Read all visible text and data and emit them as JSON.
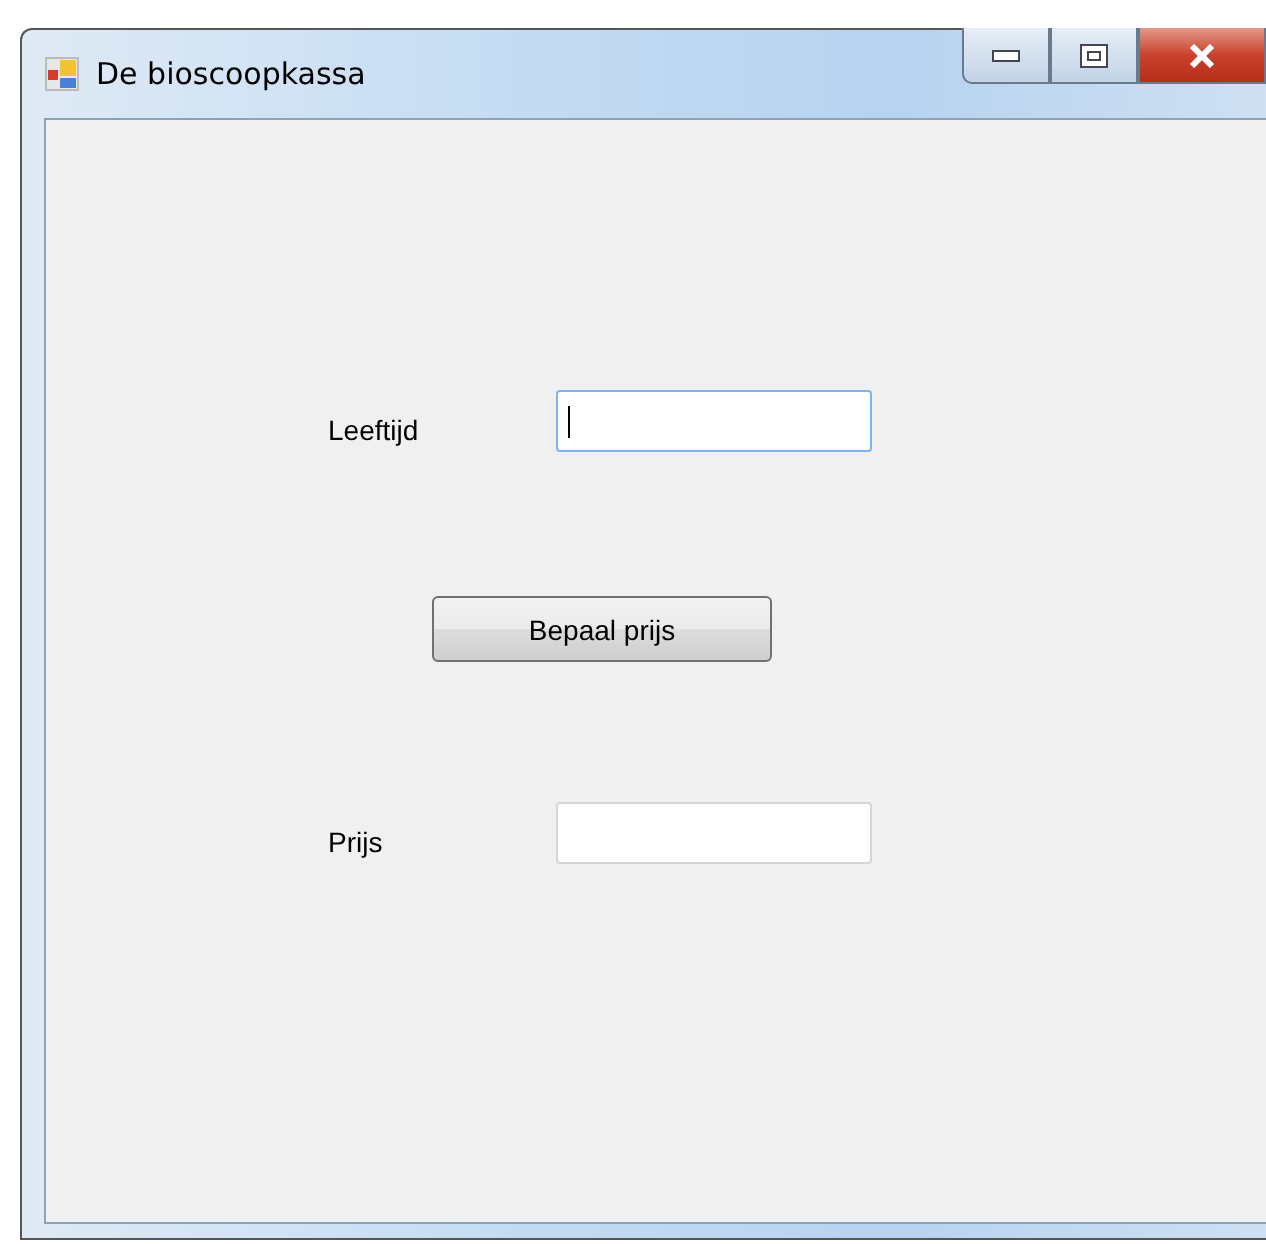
{
  "window": {
    "title": "De bioscoopkassa"
  },
  "fields": [
    {
      "label": "Leeftijd",
      "focused": true
    },
    {
      "label": "Prijs",
      "focused": false
    }
  ],
  "button": {
    "label": "Bepaal prijs"
  }
}
